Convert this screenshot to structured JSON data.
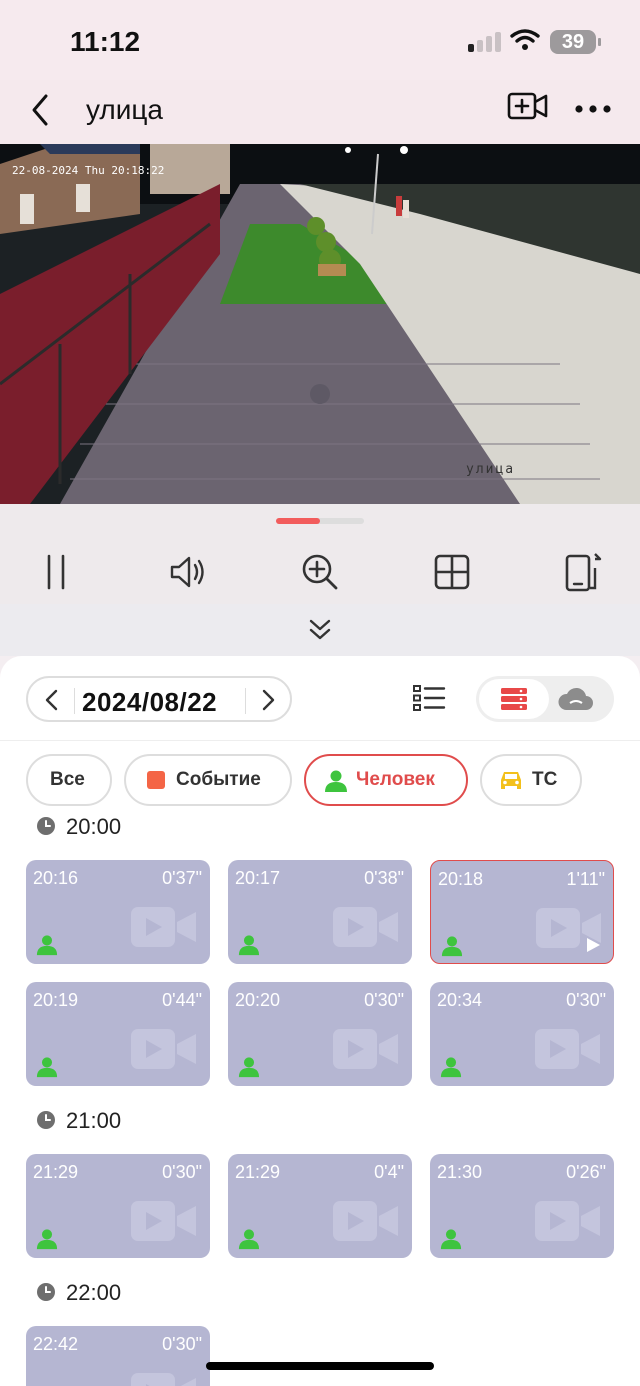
{
  "status": {
    "time": "11:12",
    "battery": "39"
  },
  "nav": {
    "title": "улица"
  },
  "video": {
    "timestamp": "22-08-2024 Thu 20:18:22",
    "camera_label": "улица"
  },
  "toolbar": {
    "icons": [
      "pause-icon",
      "speaker-icon",
      "zoom-in-icon",
      "grid-icon",
      "screenshot-icon"
    ]
  },
  "playback": {
    "date": "2024/08/22",
    "storage_options": [
      "sd-card",
      "cloud"
    ],
    "selected_storage": "sd-card"
  },
  "filters": {
    "all": "Все",
    "event": "Событие",
    "person": "Человек",
    "vehicle": "ТС",
    "active": "person"
  },
  "colors": {
    "accent": "#e04c4c",
    "person": "#3ec43e",
    "event": "#f46546",
    "vehicle": "#f3c01c",
    "clip_bg": "#b5b6d2"
  },
  "sections": [
    {
      "hour": "20:00",
      "clips": [
        {
          "start": "20:16",
          "duration": "0'37\""
        },
        {
          "start": "20:17",
          "duration": "0'38\""
        },
        {
          "start": "20:18",
          "duration": "1'11\"",
          "selected": true
        },
        {
          "start": "20:19",
          "duration": "0'44\""
        },
        {
          "start": "20:20",
          "duration": "0'30\""
        },
        {
          "start": "20:34",
          "duration": "0'30\""
        }
      ]
    },
    {
      "hour": "21:00",
      "clips": [
        {
          "start": "21:29",
          "duration": "0'30\""
        },
        {
          "start": "21:29",
          "duration": "0'4\""
        },
        {
          "start": "21:30",
          "duration": "0'26\""
        }
      ]
    },
    {
      "hour": "22:00",
      "clips": [
        {
          "start": "22:42",
          "duration": "0'30\""
        }
      ]
    }
  ]
}
